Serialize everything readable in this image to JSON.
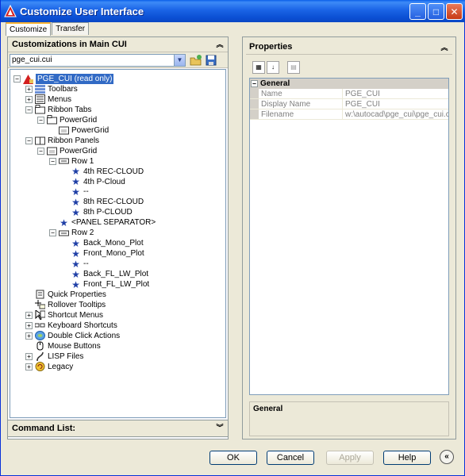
{
  "window": {
    "title": "Customize User Interface",
    "minimize": "_",
    "maximize": "□",
    "close": "✕"
  },
  "tabs": [
    {
      "label": "Customize",
      "active": true
    },
    {
      "label": "Transfer",
      "active": false
    }
  ],
  "left_panel": {
    "header": "Customizations in Main CUI",
    "combo_value": "pge_cui.cui",
    "tree": [
      {
        "label": "PGE_CUI (read only)",
        "exp": "−",
        "icon": "cui-file-icon"
      },
      {
        "label": "Toolbars",
        "exp": "+",
        "icon": "toolbars-icon"
      },
      {
        "label": "Menus",
        "exp": "+",
        "icon": "menus-icon"
      },
      {
        "label": "Ribbon Tabs",
        "exp": "−",
        "icon": "ribbon-tabs-icon"
      },
      {
        "label": "PowerGrid",
        "exp": "−",
        "icon": "ribbon-tab-icon"
      },
      {
        "label": "PowerGrid",
        "exp": "",
        "icon": "ribbon-panel-ref-icon"
      },
      {
        "label": "Ribbon Panels",
        "exp": "−",
        "icon": "ribbon-panels-icon"
      },
      {
        "label": "PowerGrid",
        "exp": "−",
        "icon": "ribbon-panel-icon"
      },
      {
        "label": "Row 1",
        "exp": "−",
        "icon": "row-icon"
      },
      {
        "label": "4th REC-CLOUD",
        "exp": "",
        "icon": "command-star-icon"
      },
      {
        "label": "4th P-Cloud",
        "exp": "",
        "icon": "command-star-icon"
      },
      {
        "label": "--",
        "exp": "",
        "icon": "command-star-icon"
      },
      {
        "label": "8th REC-CLOUD",
        "exp": "",
        "icon": "command-star-icon"
      },
      {
        "label": "8th P-CLOUD",
        "exp": "",
        "icon": "command-star-icon"
      },
      {
        "label": "<PANEL SEPARATOR>",
        "exp": "",
        "icon": "command-star-icon"
      },
      {
        "label": "Row 2",
        "exp": "−",
        "icon": "row-icon"
      },
      {
        "label": "Back_Mono_Plot",
        "exp": "",
        "icon": "command-star-icon"
      },
      {
        "label": "Front_Mono_Plot",
        "exp": "",
        "icon": "command-star-icon"
      },
      {
        "label": "--",
        "exp": "",
        "icon": "command-star-icon"
      },
      {
        "label": "Back_FL_LW_Plot",
        "exp": "",
        "icon": "command-star-icon"
      },
      {
        "label": "Front_FL_LW_Plot",
        "exp": "",
        "icon": "command-star-icon"
      },
      {
        "label": "Quick Properties",
        "exp": "",
        "icon": "quick-properties-icon"
      },
      {
        "label": "Rollover Tooltips",
        "exp": "",
        "icon": "rollover-tooltips-icon"
      },
      {
        "label": "Shortcut Menus",
        "exp": "+",
        "icon": "shortcut-menus-icon"
      },
      {
        "label": "Keyboard Shortcuts",
        "exp": "+",
        "icon": "keyboard-shortcuts-icon"
      },
      {
        "label": "Double Click Actions",
        "exp": "+",
        "icon": "double-click-icon"
      },
      {
        "label": "Mouse Buttons",
        "exp": "",
        "icon": "mouse-buttons-icon"
      },
      {
        "label": "LISP Files",
        "exp": "+",
        "icon": "lisp-files-icon"
      },
      {
        "label": "Legacy",
        "exp": "+",
        "icon": "legacy-icon"
      }
    ],
    "command_list": "Command List:"
  },
  "right_panel": {
    "header": "Properties",
    "category": "General",
    "rows": [
      {
        "name": "Name",
        "value": "PGE_CUI"
      },
      {
        "name": "Display Name",
        "value": "PGE_CUI"
      },
      {
        "name": "Filename",
        "value": "w:\\autocad\\pge_cui\\pge_cui.cui"
      }
    ],
    "description_title": "General"
  },
  "buttons": {
    "ok": "OK",
    "cancel": "Cancel",
    "apply": "Apply",
    "help": "Help"
  },
  "colors": {
    "selection": "#316ac5",
    "titlebar": "#0b4fd3",
    "command_star": "#1f3fa6"
  }
}
